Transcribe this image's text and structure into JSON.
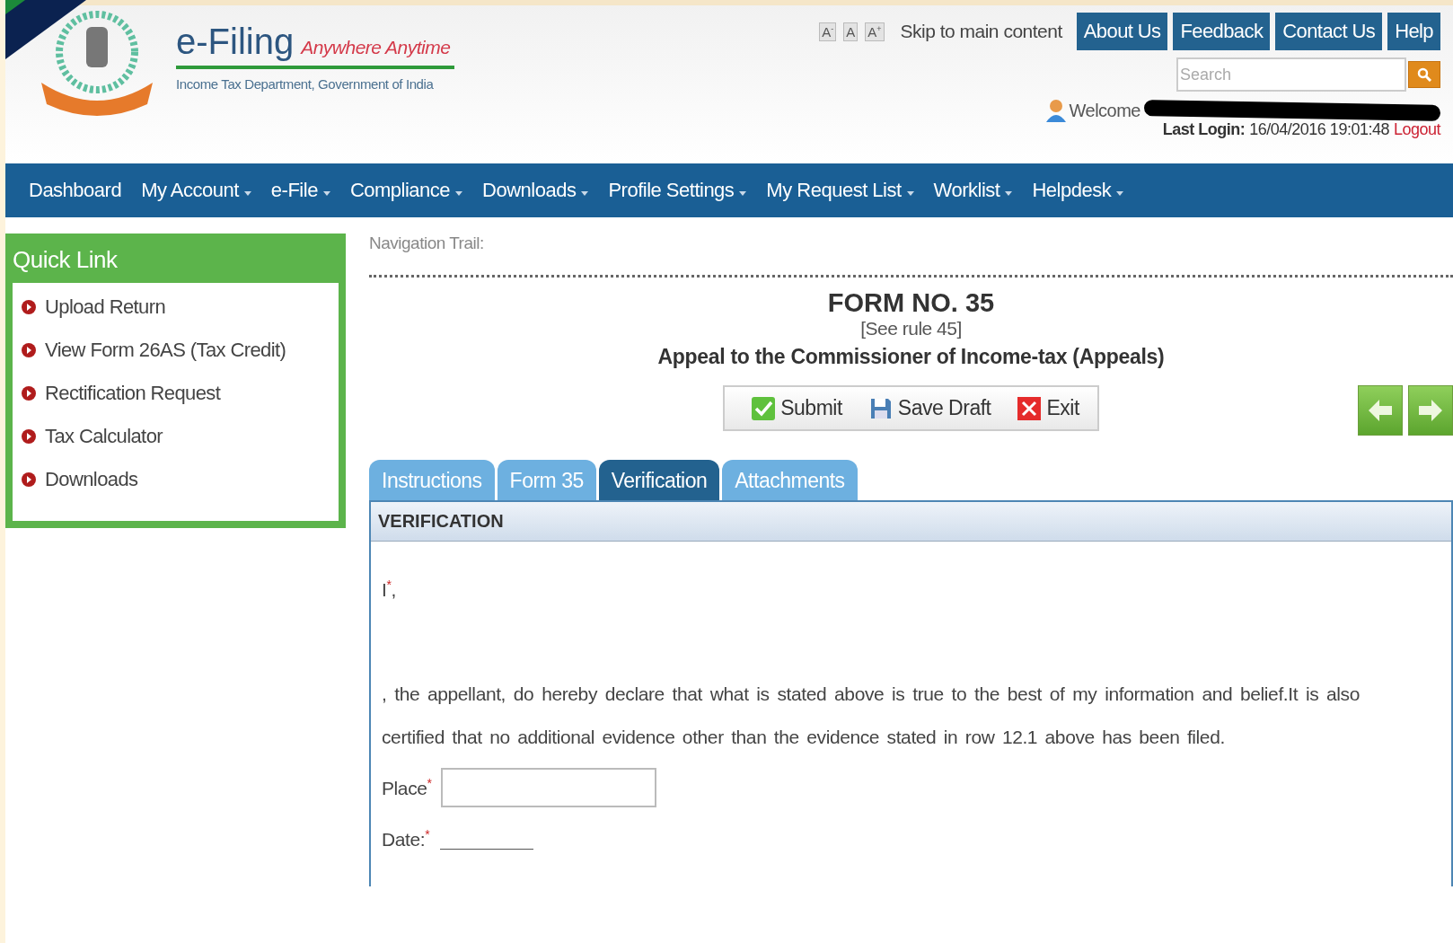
{
  "header": {
    "brand": "e-Filing",
    "tagline": "Anywhere Anytime",
    "department": "Income Tax Department, Government of India",
    "font_sizes": [
      {
        "label": "A",
        "sup": "-"
      },
      {
        "label": "A"
      },
      {
        "label": "A",
        "sup": "+"
      }
    ],
    "skip_link": "Skip to main content",
    "top_links": [
      "About Us",
      "Feedback",
      "Contact Us",
      "Help"
    ],
    "search": {
      "placeholder": "Search"
    },
    "welcome": "Welcome",
    "redacted": true,
    "last_login_label": "Last Login:",
    "last_login_value": "16/04/2016 19:01:48",
    "logout": "Logout"
  },
  "nav": [
    {
      "label": "Dashboard",
      "has_menu": false
    },
    {
      "label": "My Account",
      "has_menu": true
    },
    {
      "label": "e-File",
      "has_menu": true
    },
    {
      "label": "Compliance",
      "has_menu": true
    },
    {
      "label": "Downloads",
      "has_menu": true
    },
    {
      "label": "Profile Settings",
      "has_menu": true
    },
    {
      "label": "My Request List",
      "has_menu": true
    },
    {
      "label": "Worklist",
      "has_menu": true
    },
    {
      "label": "Helpdesk",
      "has_menu": true
    }
  ],
  "quick_link": {
    "title": "Quick Link",
    "items": [
      "Upload Return",
      "View Form 26AS (Tax Credit)",
      "Rectification Request",
      "Tax Calculator",
      "Downloads"
    ]
  },
  "navigation_trail": "Navigation Trail:",
  "form": {
    "title": "FORM NO. 35",
    "rule": "[See rule 45]",
    "subtitle": "Appeal to the Commissioner of Income-tax (Appeals)",
    "actions": [
      {
        "kind": "submit",
        "label": "Submit"
      },
      {
        "kind": "save",
        "label": "Save Draft"
      },
      {
        "kind": "exit",
        "label": "Exit"
      }
    ],
    "tabs": [
      {
        "label": "Instructions",
        "selected": false
      },
      {
        "label": "Form 35",
        "selected": false
      },
      {
        "label": "Verification",
        "selected": true
      },
      {
        "label": "Attachments",
        "selected": false
      }
    ],
    "section_title": "VERIFICATION",
    "declarant": {
      "label": "I",
      "mark": "*",
      "suffix": ","
    },
    "declaration": ", the appellant, do hereby declare that what is stated above is true to the best of my information and belief.It is also certified that no additional evidence other than the evidence stated in row 12.1 above has been filed.",
    "fields": [
      {
        "kind": "input",
        "label": "Place",
        "mark": "*"
      },
      {
        "kind": "line",
        "label": "Date:",
        "mark": "*"
      }
    ]
  }
}
